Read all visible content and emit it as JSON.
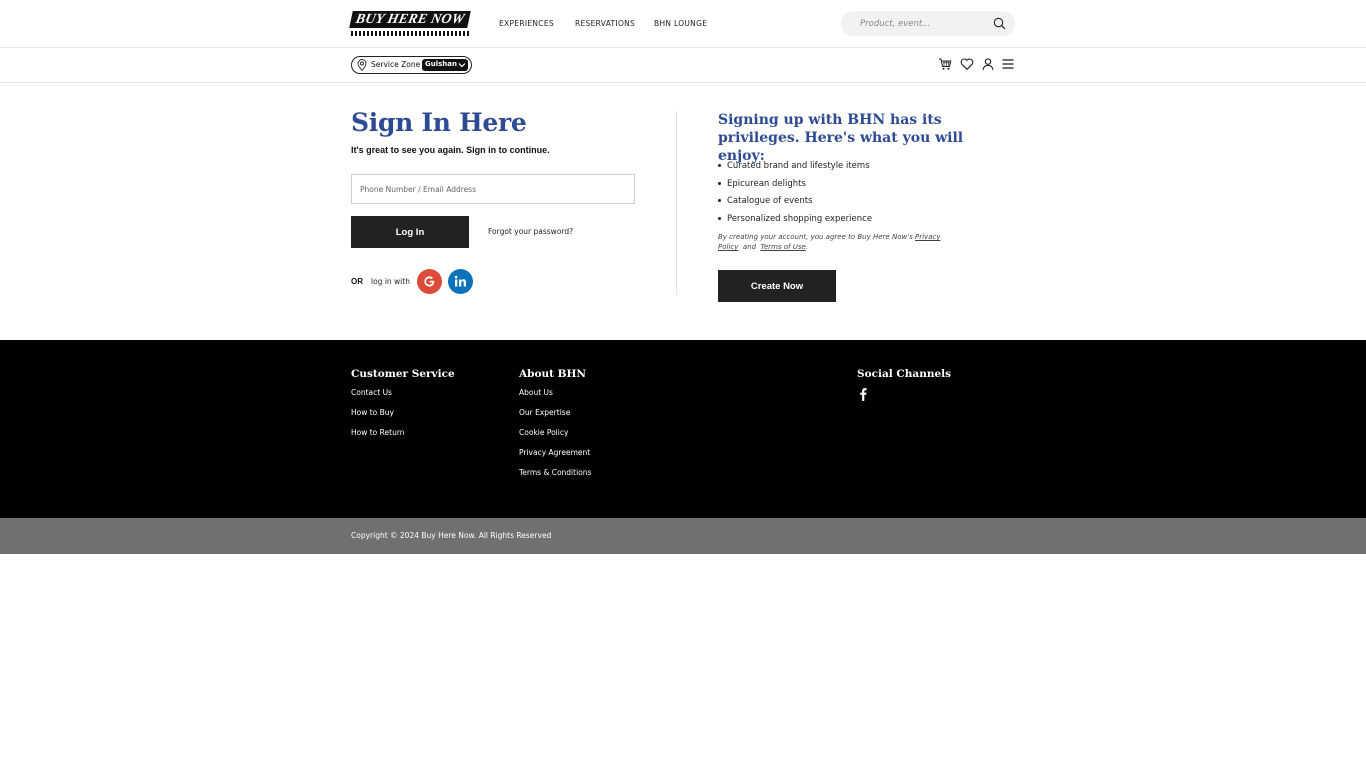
{
  "header": {
    "logo_text": "BUY HERE NOW",
    "nav": {
      "experiences": "EXPERIENCES",
      "reservations": "RESERVATIONS",
      "lounge": "BHN LOUNGE"
    },
    "search": {
      "placeholder": "Product, event..."
    }
  },
  "subbar": {
    "service_zone_label": "Service Zone",
    "service_zone_value": "Gulshan",
    "icons": [
      "cart-icon",
      "heart-icon",
      "user-icon",
      "menu-icon"
    ]
  },
  "signin": {
    "title": "Sign In Here",
    "subtitle": "It's great to see you again. Sign in to continue.",
    "input_placeholder": "Phone Number / Email Address",
    "login_label": "Log In",
    "forgot_label": "Forgot your password?",
    "or_label": "OR",
    "login_with_label": "log in with"
  },
  "benefits": {
    "title": "Signing up with BHN has its privileges. Here's what you will enjoy:",
    "items": [
      "Curated brand and lifestyle items",
      "Epicurean delights",
      "Catalogue of events",
      "Personalized shopping experience"
    ],
    "terms_prefix": "By creating your account, you agree to Buy Here Now's",
    "privacy_link": "Privacy Policy",
    "and_word": "and",
    "terms_link": "Terms of Use",
    "terms_suffix": ".",
    "create_label": "Create Now"
  },
  "footer": {
    "customer_service": {
      "heading": "Customer Service",
      "links": [
        "Contact Us",
        "How to Buy",
        "How to Return"
      ]
    },
    "about": {
      "heading": "About BHN",
      "links": [
        "About Us",
        "Our Expertise",
        "Cookie Policy",
        "Privacy Agreement",
        "Terms & Conditions"
      ]
    },
    "social": {
      "heading": "Social Channels",
      "icons": [
        "facebook-icon"
      ]
    },
    "copyright": "Copyright © 2024 Buy Here Now. All Rights Reserved"
  },
  "colors": {
    "brand_blue": "#2d4a93",
    "button_dark": "#222222",
    "footer_bg": "#000000",
    "copyright_bg": "#707070",
    "google_red": "#dd4b39",
    "linkedin_blue": "#0a72b8"
  }
}
